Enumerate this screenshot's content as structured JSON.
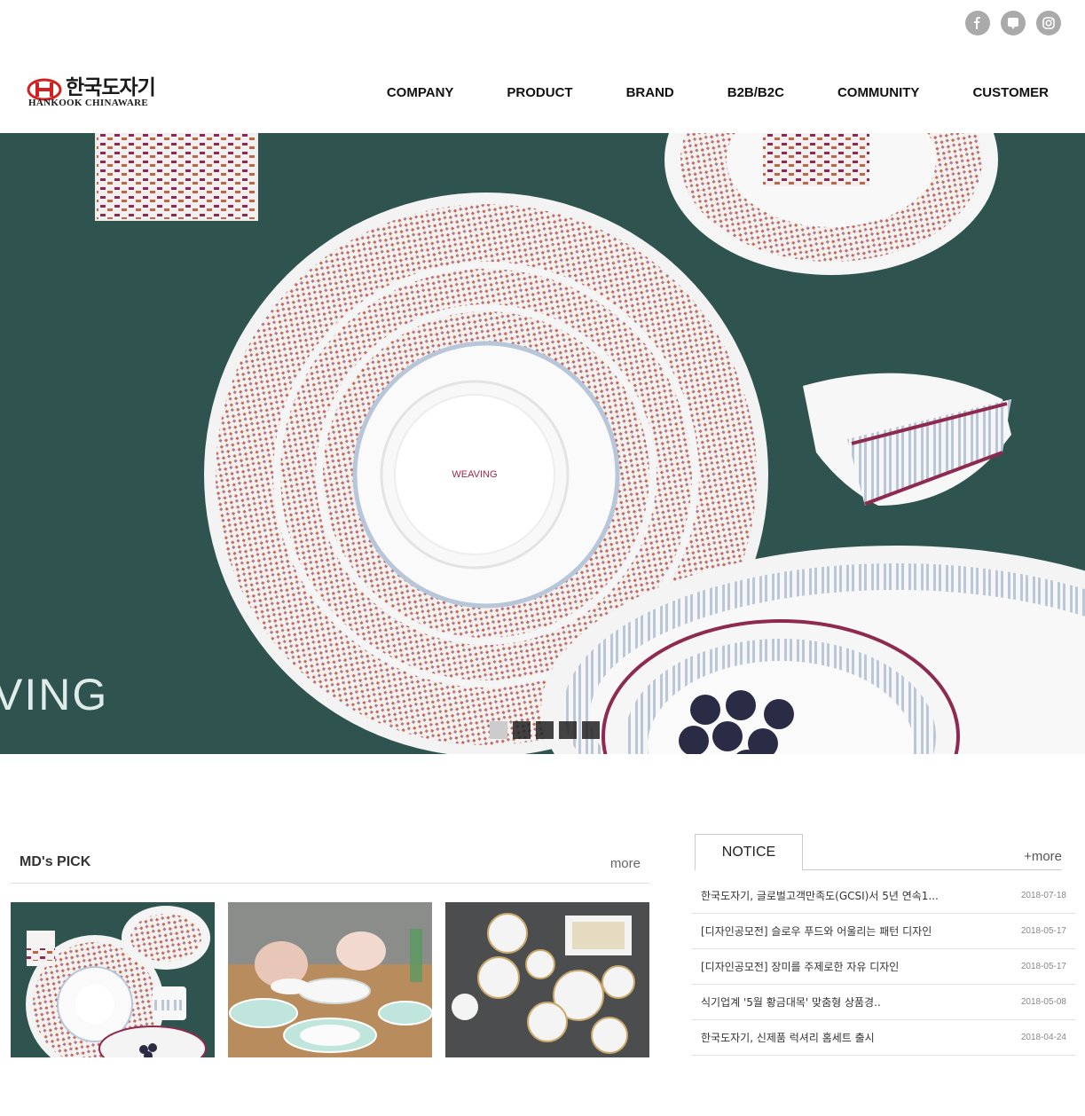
{
  "social": [
    {
      "name": "facebook-icon",
      "glyph": "f"
    },
    {
      "name": "kakao-talk-icon",
      "glyph": ""
    },
    {
      "name": "instagram-icon",
      "glyph": ""
    }
  ],
  "header": {
    "logo_ko": "한국도자기",
    "logo_en": "HANKOOK CHINAWARE",
    "nav": [
      "COMPANY",
      "PRODUCT",
      "BRAND",
      "B2B/B2C",
      "COMMUNITY",
      "CUSTOMER"
    ]
  },
  "hero": {
    "brand_text": "VING",
    "plate_stamp": "WEAVING",
    "slides": 5,
    "active_slide": 1
  },
  "mds_pick": {
    "title": "MD's PICK",
    "more": "more"
  },
  "notice": {
    "tab": "NOTICE",
    "more": "+more",
    "items": [
      {
        "title": "한국도자기, 글로벌고객만족도(GCSI)서 5년 연속1...",
        "date": "2018-07-18"
      },
      {
        "title": "[디자인공모전] 슬로우 푸드와 어울리는 패턴 디자인",
        "date": "2018-05-17"
      },
      {
        "title": "[디자인공모전] 장미를 주제로한 자유 디자인",
        "date": "2018-05-17"
      },
      {
        "title": "식기업계 '5월 황금대목' 맞춤형 상품경..",
        "date": "2018-05-08"
      },
      {
        "title": "한국도자기, 신제품 럭셔리 홈세트 출시",
        "date": "2018-04-24"
      }
    ]
  },
  "colors": {
    "hero_bg": "#2f5450",
    "accent_red": "#d2201f",
    "social_gray": "#aaaaaa"
  }
}
